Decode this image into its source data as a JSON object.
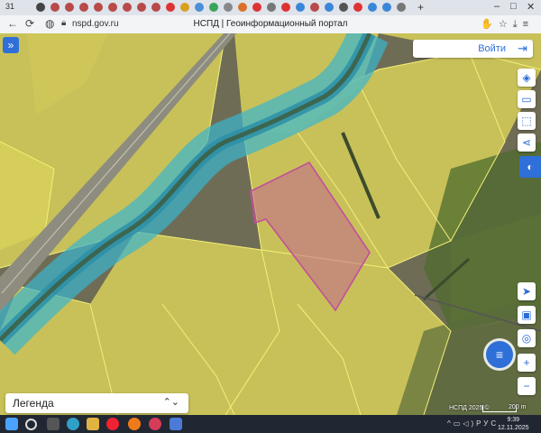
{
  "browser": {
    "tab_count_label": "31",
    "new_tab_glyph": "+",
    "url": "nspd.gov.ru",
    "title": "НСПД | Геоинформационный портал",
    "nav": {
      "back": "←",
      "forward": "→",
      "reload": "⟳"
    }
  },
  "map": {
    "login_label": "Войти",
    "legend_label": "Легенда",
    "copyright": "НСПД 2025 ©",
    "scale_label": "200 m",
    "controls_top": [
      "layers-icon",
      "ruler-icon",
      "select-area-icon",
      "share-icon"
    ],
    "controls_bottom": [
      "locate-icon",
      "screen-icon",
      "search-location-icon"
    ],
    "zoom_in": "+",
    "zoom_out": "−",
    "colors": {
      "parcel_fill": "#d8d05a",
      "parcel_border": "#f3ef7a",
      "water_zone": "#39b5cf",
      "selected_parcel": "#c2509a",
      "accent": "#2f6fd8"
    }
  },
  "taskbar": {
    "language": "РУС",
    "time": "9:39",
    "date": "12.11.2025"
  }
}
